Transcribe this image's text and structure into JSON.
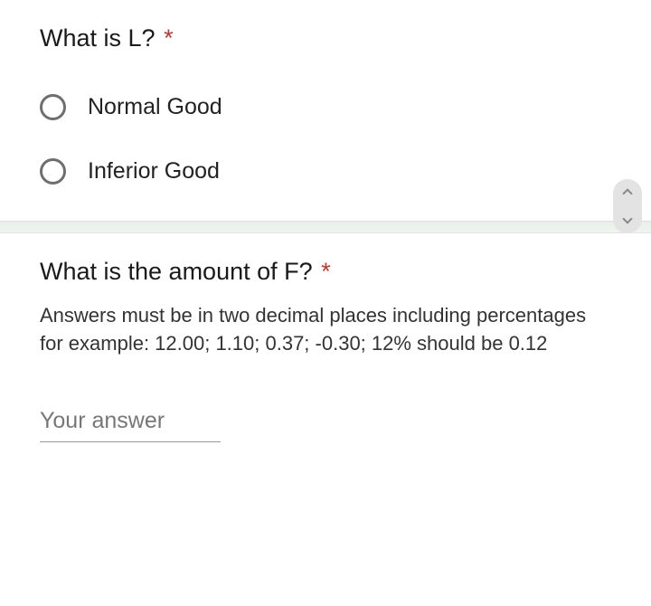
{
  "q1": {
    "title": "What is L?",
    "required_marker": "*",
    "options": [
      {
        "label": "Normal Good"
      },
      {
        "label": "Inferior Good"
      }
    ]
  },
  "q2": {
    "title": "What is the amount of F?",
    "required_marker": "*",
    "helper": "Answers must be in two decimal places including percentages for example: 12.00; 1.10; 0.37; -0.30; 12% should be 0.12",
    "answer_placeholder": "Your answer"
  }
}
